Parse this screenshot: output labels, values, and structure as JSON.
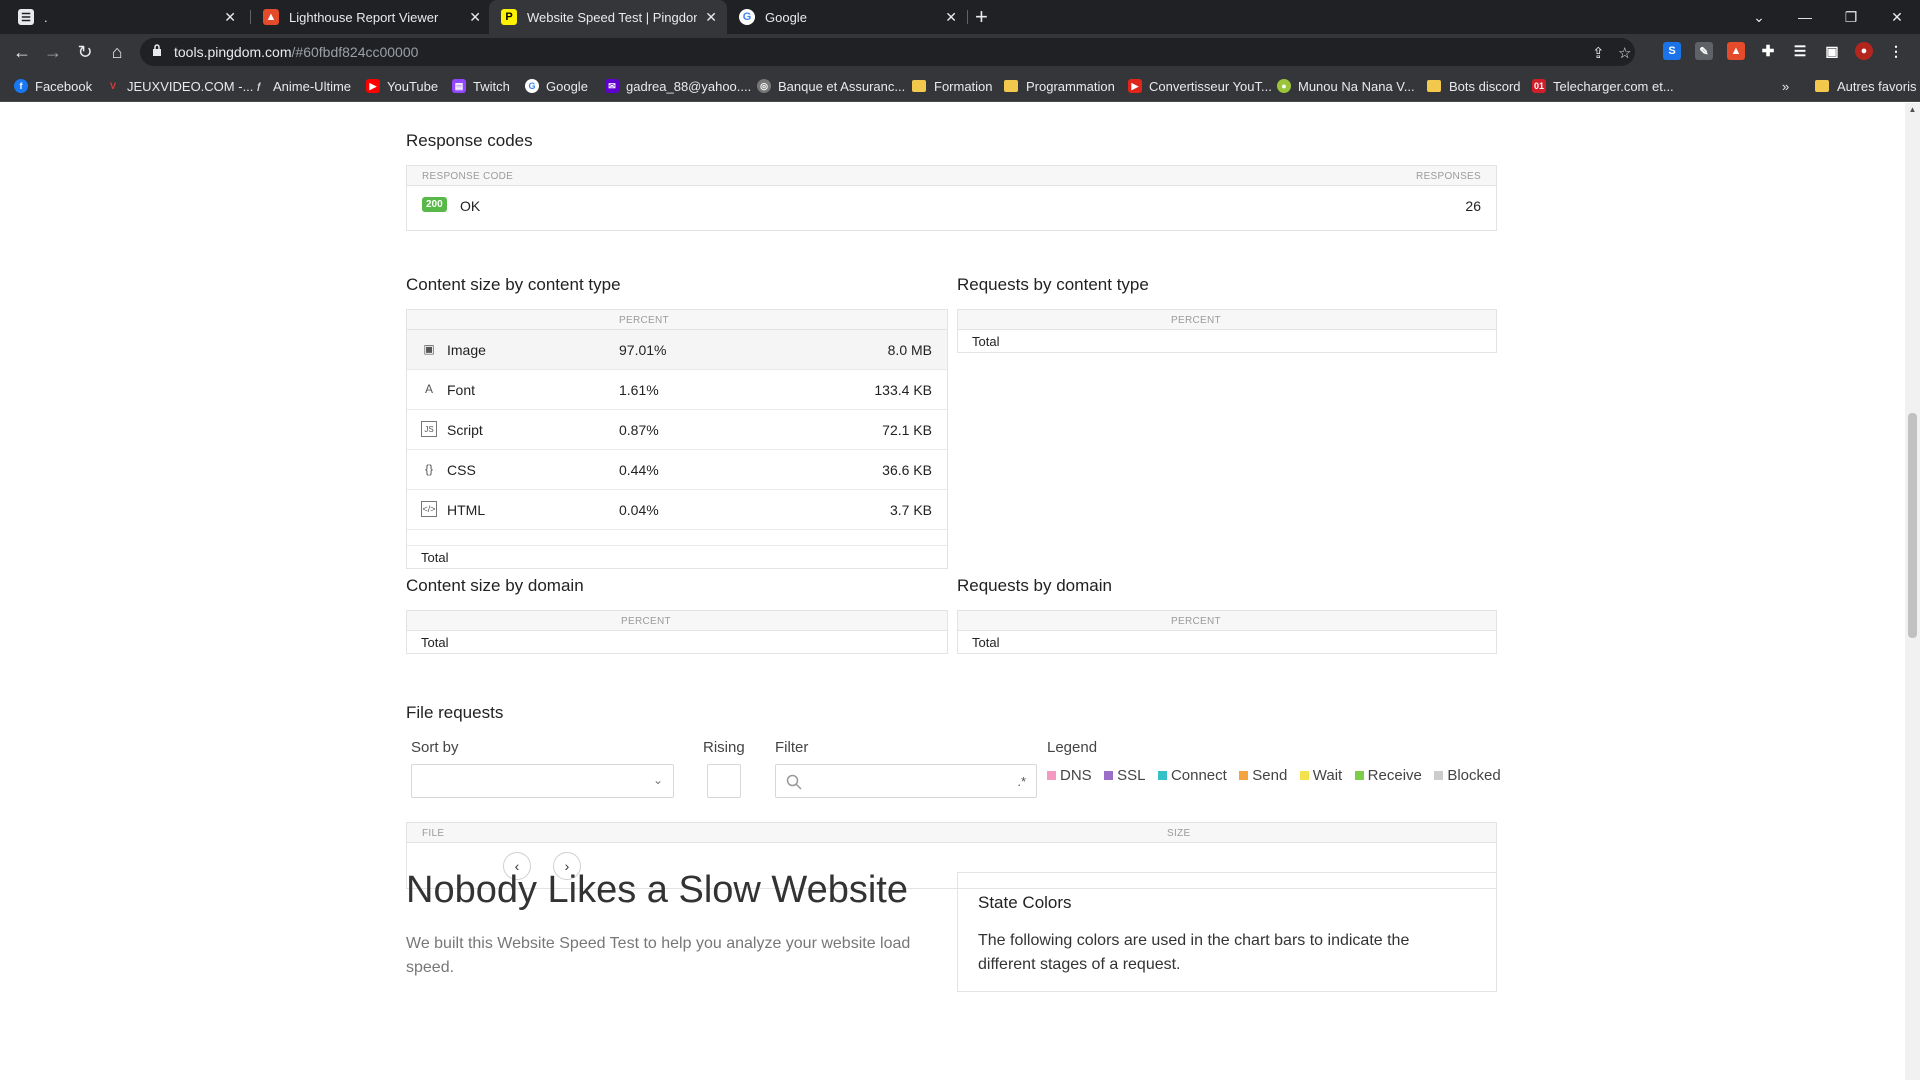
{
  "browser": {
    "tabs": [
      {
        "title": "."
      },
      {
        "title": "Lighthouse Report Viewer"
      },
      {
        "title": "Website Speed Test | Pingdom To"
      },
      {
        "title": "Google"
      }
    ],
    "url_host": "tools.pingdom.com",
    "url_path": "/#60fbdf824cc00000",
    "bookmarks": [
      "Facebook",
      "JEUXVIDEO.COM -...",
      "Anime-Ultime",
      "YouTube",
      "Twitch",
      "Google",
      "gadrea_88@yahoo....",
      "Banque et Assuranc...",
      "Formation",
      "Programmation",
      "Convertisseur YouT...",
      "Munou Na Nana V...",
      "Bots discord",
      "Telecharger.com et...",
      "Autres favoris"
    ],
    "more_bookmarks": "»"
  },
  "response_codes": {
    "title": "Response codes",
    "col_code": "RESPONSE CODE",
    "col_responses": "RESPONSES",
    "rows": [
      {
        "code": "200",
        "label": "OK",
        "count": "26"
      }
    ]
  },
  "content_size_type": {
    "title": "Content size by content type",
    "col_percent": "PERCENT",
    "rows": [
      {
        "icon": "image-icon",
        "type": "Image",
        "percent": "97.01%",
        "size": "8.0 MB"
      },
      {
        "icon": "font-icon",
        "type": "Font",
        "percent": "1.61%",
        "size": "133.4 KB"
      },
      {
        "icon": "script-icon",
        "type": "Script",
        "percent": "0.87%",
        "size": "72.1 KB"
      },
      {
        "icon": "css-icon",
        "type": "CSS",
        "percent": "0.44%",
        "size": "36.6 KB"
      },
      {
        "icon": "html-icon",
        "type": "HTML",
        "percent": "0.04%",
        "size": "3.7 KB"
      }
    ],
    "total": "Total"
  },
  "requests_type": {
    "title": "Requests by content type",
    "col_percent": "PERCENT",
    "total": "Total"
  },
  "content_size_domain": {
    "title": "Content size by domain",
    "col_percent": "PERCENT",
    "total": "Total"
  },
  "requests_domain": {
    "title": "Requests by domain",
    "col_percent": "PERCENT",
    "total": "Total"
  },
  "file_requests": {
    "title": "File requests",
    "sort_by": "Sort by",
    "rising": "Rising",
    "filter": "Filter",
    "filter_suffix": ".*",
    "legend_title": "Legend",
    "legend": [
      {
        "label": "DNS",
        "color": "#f49ac2"
      },
      {
        "label": "SSL",
        "color": "#9b6ec8"
      },
      {
        "label": "Connect",
        "color": "#35c0c8"
      },
      {
        "label": "Send",
        "color": "#f5a442"
      },
      {
        "label": "Wait",
        "color": "#f4e24c"
      },
      {
        "label": "Receive",
        "color": "#7ccd4a"
      },
      {
        "label": "Blocked",
        "color": "#cccccc"
      }
    ],
    "col_file": "FILE",
    "col_size": "SIZE"
  },
  "footer": {
    "headline": "Nobody Likes a Slow Website",
    "paragraph": "We built this Website Speed Test to help you analyze your website load speed.",
    "state_title": "State Colors",
    "state_text": "The following colors are used in the chart bars to indicate the different stages of a request."
  }
}
